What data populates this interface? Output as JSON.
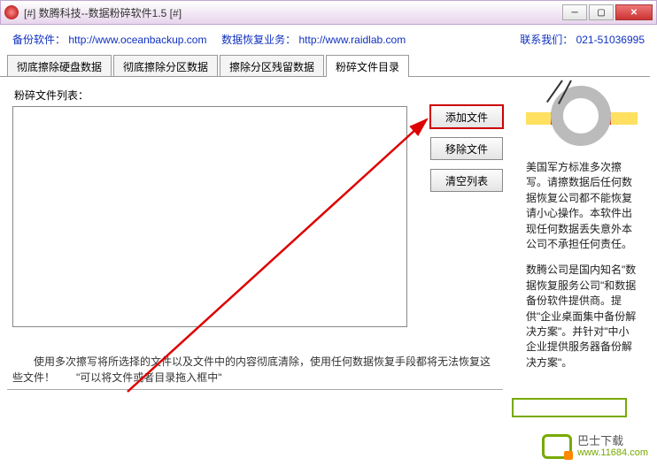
{
  "window": {
    "title": "[#] 数腾科技--数据粉碎软件1.5 [#]"
  },
  "header": {
    "backup_label": "备份软件：",
    "backup_url": "http://www.oceanbackup.com",
    "recovery_label": "数据恢复业务：",
    "recovery_url": "http://www.raidlab.com",
    "contact_label": "联系我们：",
    "contact_value": "021-51036995"
  },
  "tabs": [
    {
      "label": "彻底擦除硬盘数据"
    },
    {
      "label": "彻底擦除分区数据"
    },
    {
      "label": "擦除分区残留数据"
    },
    {
      "label": "粉碎文件目录"
    }
  ],
  "list": {
    "label": "粉碎文件列表："
  },
  "buttons": {
    "add": "添加文件",
    "remove": "移除文件",
    "clear": "清空列表"
  },
  "description": "使用多次擦写将所选择的文件以及文件中的内容彻底清除，使用任何数据恢复手段都将无法恢复这些文件！　　\"可以将文件或者目录拖入框中\"",
  "info1": "美国军方标准多次擦写。请擦数据后任何数据恢复公司都不能恢复请小心操作。本软件出现任何数据丢失意外本公司不承担任何责任。",
  "info2": "数腾公司是国内知名\"数据恢复服务公司\"和数据备份软件提供商。提供\"企业桌面集中备份解决方案\"。并针对\"中小企业提供服务器备份解决方案\"。",
  "watermark": {
    "brand": "巴士下载",
    "url": "www.11684.com"
  }
}
